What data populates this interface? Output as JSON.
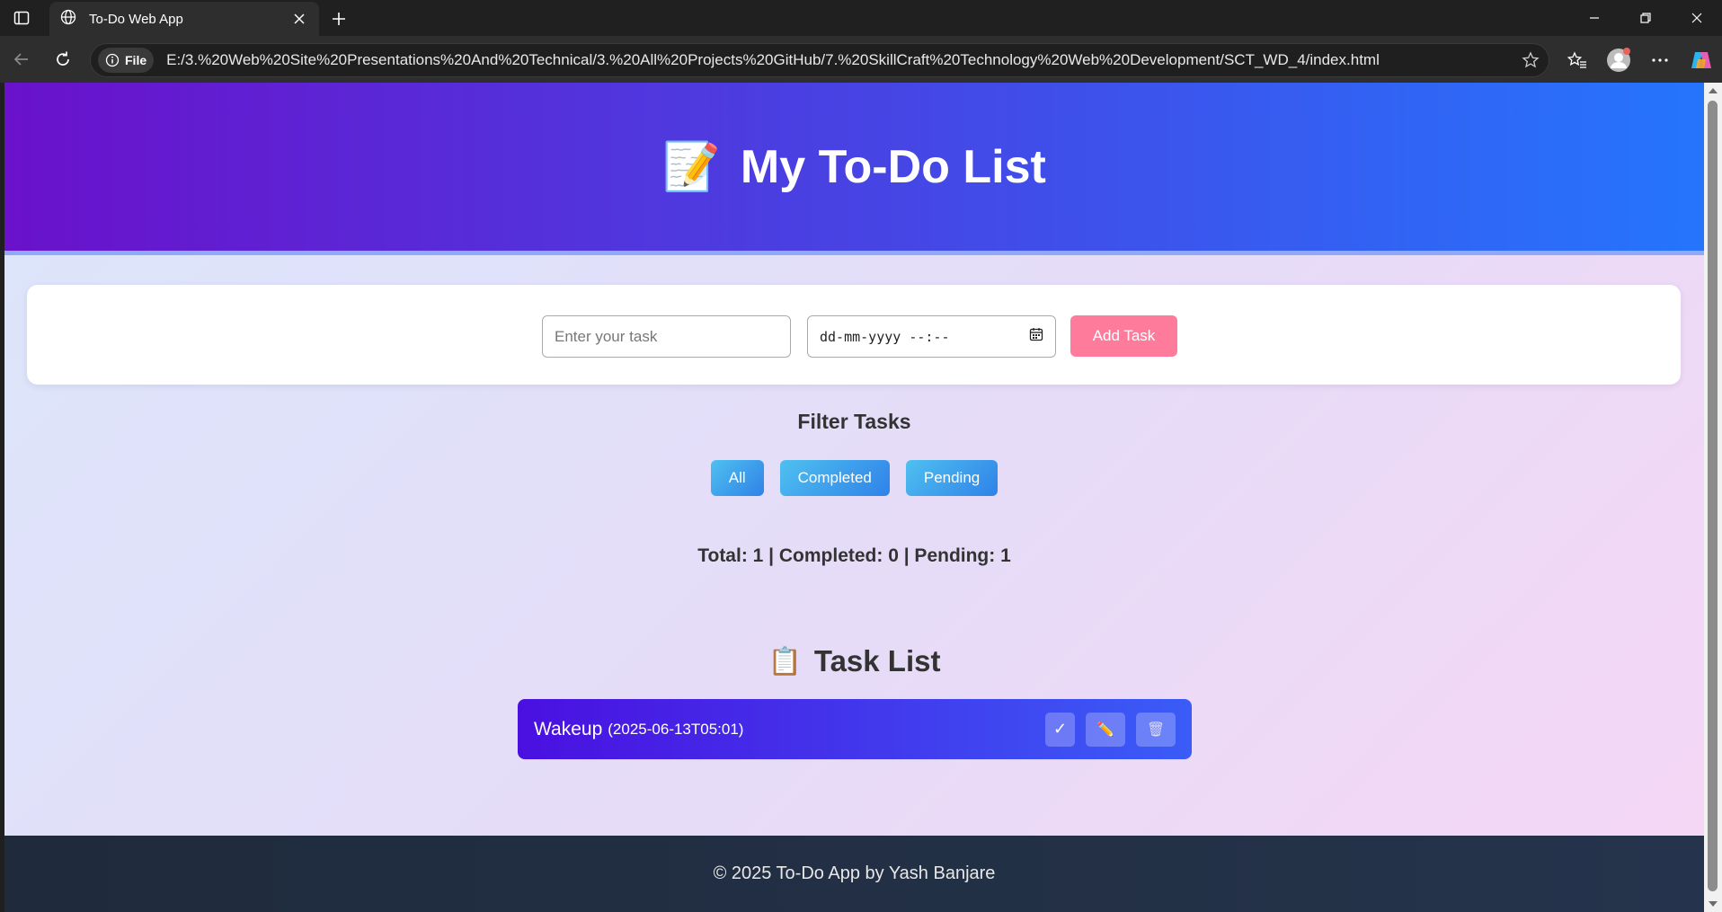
{
  "browser": {
    "tab_title": "To-Do Web App",
    "site_info_label": "File",
    "url": "E:/3.%20Web%20Site%20Presentations%20And%20Technical/3.%20All%20Projects%20GitHub/7.%20SkillCraft%20Technology%20Web%20Development/SCT_WD_4/index.html"
  },
  "header": {
    "emoji": "📝",
    "title": "My To-Do List"
  },
  "form": {
    "task_placeholder": "Enter your task",
    "task_value": "",
    "date_placeholder": "dd-mm-yyyy --:--",
    "add_label": "Add Task"
  },
  "filter": {
    "title": "Filter Tasks",
    "buttons": [
      "All",
      "Completed",
      "Pending"
    ]
  },
  "stats": {
    "text": "Total: 1 | Completed: 0 | Pending: 1"
  },
  "task_list": {
    "emoji": "📋",
    "title": "Task List",
    "tasks": [
      {
        "name": "Wakeup",
        "date": "(2025-06-13T05:01)",
        "complete_icon": "✓",
        "edit_icon": "✏️",
        "delete_icon": "🗑"
      }
    ]
  },
  "footer": {
    "text": "© 2025 To-Do App by Yash Banjare"
  },
  "colors": {
    "header_start": "#6a11cb",
    "header_end": "#2575fc",
    "add_button": "#ff7b9c",
    "filter_button": "#3fa3ee",
    "task_bg": "#4a10e0",
    "footer_bg": "#1f2a3c"
  }
}
